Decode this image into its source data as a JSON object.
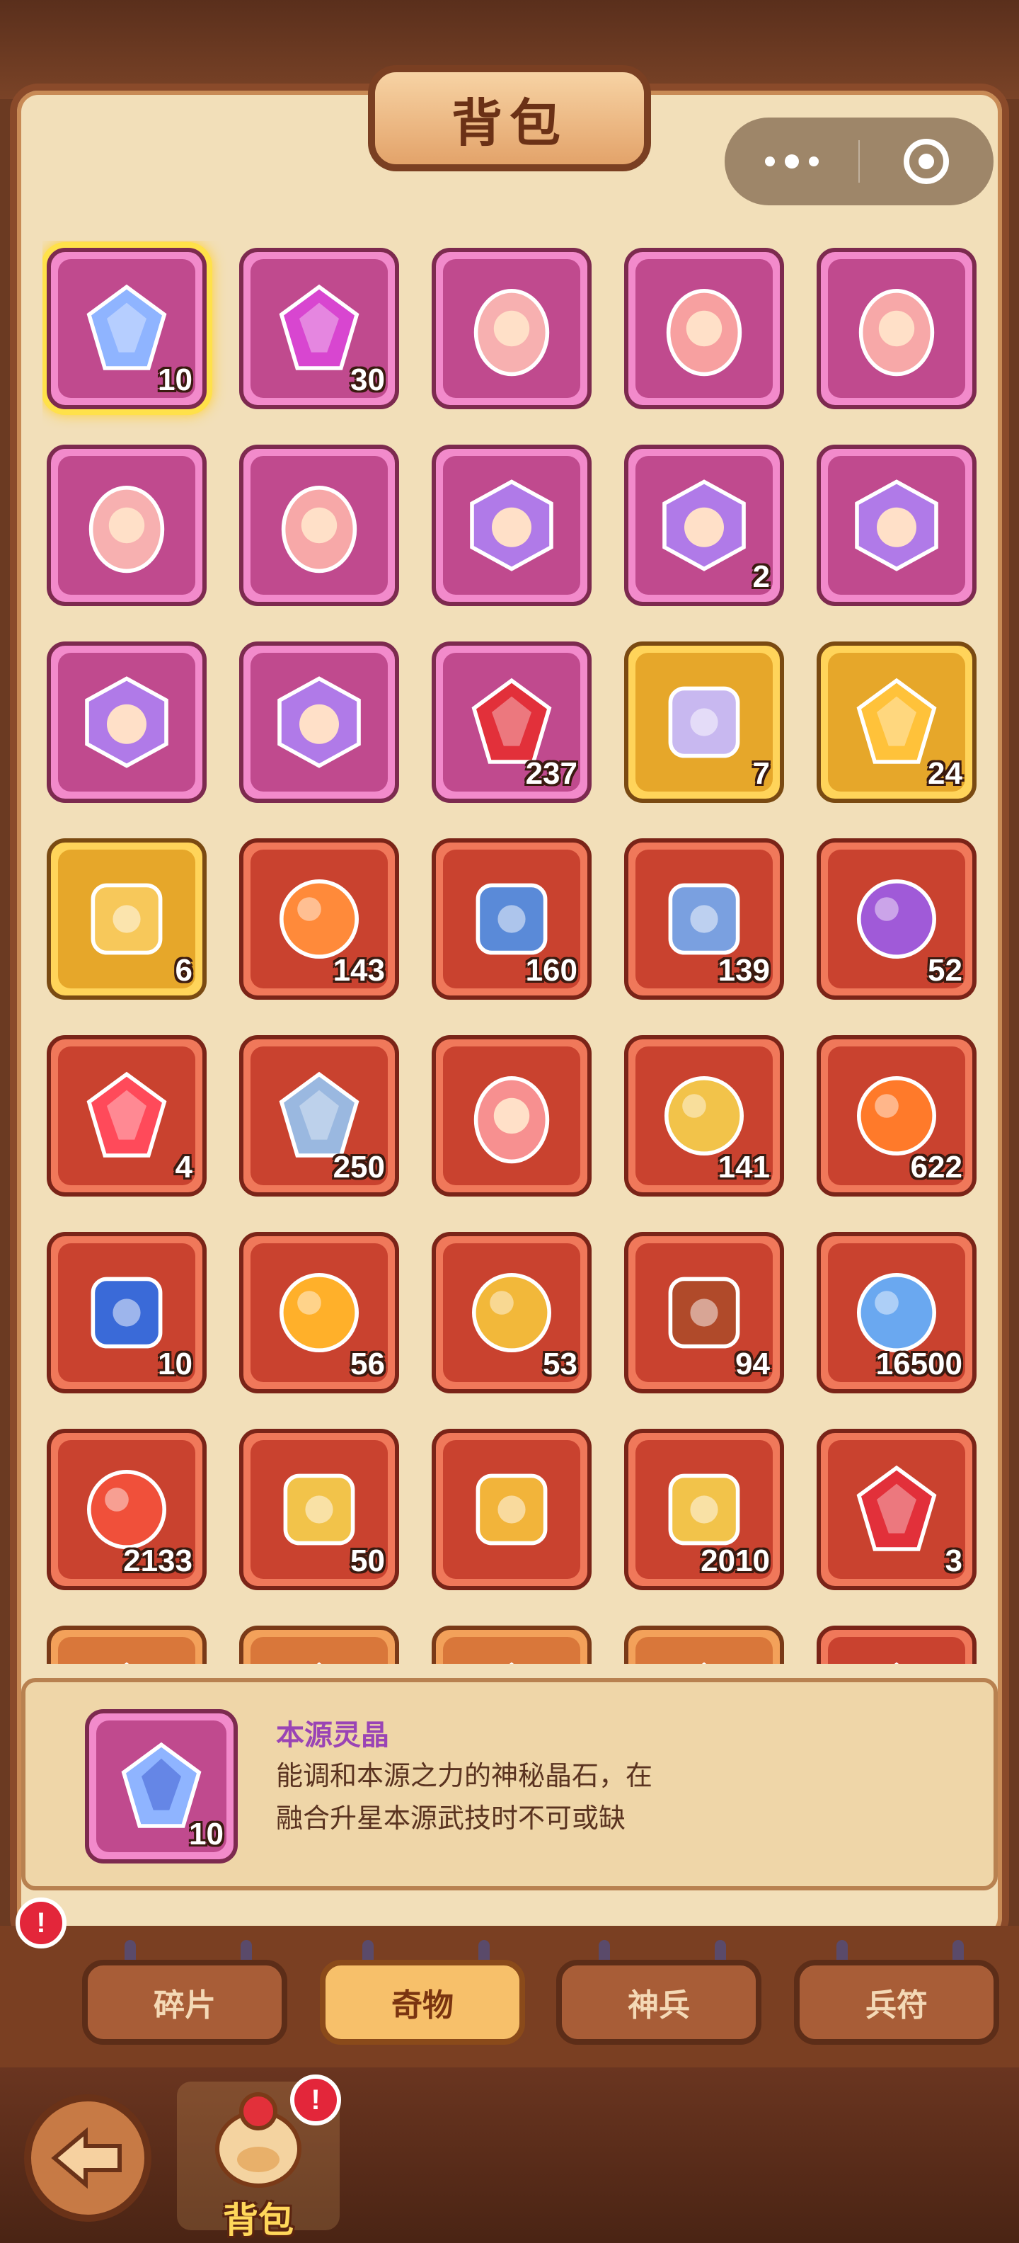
{
  "header": {
    "title": "背包"
  },
  "grid": {
    "items": [
      {
        "name": "crystal-blue-icon",
        "color": "pink",
        "count": "10",
        "selected": true,
        "glyph": "#8fb4ff"
      },
      {
        "name": "crystal-magenta-icon",
        "color": "pink",
        "count": "30",
        "glyph": "#d846d0"
      },
      {
        "name": "hero-egg-icon",
        "color": "pink",
        "count": "",
        "glyph": "#f7b0b0"
      },
      {
        "name": "hero-egg-icon",
        "color": "pink",
        "count": "",
        "glyph": "#f7a0a0"
      },
      {
        "name": "hero-egg-icon",
        "color": "pink",
        "count": "",
        "glyph": "#f7a8a8"
      },
      {
        "name": "hero-egg-icon",
        "color": "pink",
        "count": "",
        "glyph": "#f7b0b0"
      },
      {
        "name": "hero-egg-icon",
        "color": "pink",
        "count": "",
        "glyph": "#f7a8a8"
      },
      {
        "name": "hero-gem-icon",
        "color": "pink",
        "count": "",
        "glyph": "#b07ae8"
      },
      {
        "name": "hero-gem-icon",
        "color": "pink",
        "count": "2",
        "glyph": "#b07ae8"
      },
      {
        "name": "hero-gem-icon",
        "color": "pink",
        "count": "",
        "glyph": "#b07ae8"
      },
      {
        "name": "hero-gem-icon",
        "color": "pink",
        "count": "",
        "glyph": "#b07ae8"
      },
      {
        "name": "hero-gem-icon",
        "color": "pink",
        "count": "",
        "glyph": "#b07ae8"
      },
      {
        "name": "red-crystal-icon",
        "color": "pink",
        "count": "237",
        "glyph": "#e2303a"
      },
      {
        "name": "cards-icon",
        "color": "gold",
        "count": "7",
        "glyph": "#c8b8f0"
      },
      {
        "name": "gold-crystal-icon",
        "color": "gold",
        "count": "24",
        "glyph": "#ffc23a"
      },
      {
        "name": "scroll-gold-icon",
        "color": "gold",
        "count": "6",
        "glyph": "#f7c85a"
      },
      {
        "name": "flame-swirl-icon",
        "color": "red",
        "count": "143",
        "glyph": "#ff8a3a"
      },
      {
        "name": "blue-scroll-icon",
        "color": "red",
        "count": "160",
        "glyph": "#5a8ad8"
      },
      {
        "name": "book-icon",
        "color": "red",
        "count": "139",
        "glyph": "#7aa0e0"
      },
      {
        "name": "purple-orb-icon",
        "color": "red",
        "count": "52",
        "glyph": "#a05ad8"
      },
      {
        "name": "red-stone-icon",
        "color": "red",
        "count": "4",
        "glyph": "#ff4a5a"
      },
      {
        "name": "rune-stone-icon",
        "color": "red",
        "count": "250",
        "glyph": "#9ab8e0"
      },
      {
        "name": "hero-egg-icon",
        "color": "red",
        "count": "",
        "glyph": "#f79090"
      },
      {
        "name": "gold-ring-icon",
        "color": "red",
        "count": "141",
        "glyph": "#f2c34a"
      },
      {
        "name": "fire-orb-icon",
        "color": "red",
        "count": "622",
        "glyph": "#ff7a2a"
      },
      {
        "name": "treasure-chest-icon",
        "color": "red",
        "count": "10",
        "glyph": "#3a6ad8"
      },
      {
        "name": "golden-orb-icon",
        "color": "red",
        "count": "56",
        "glyph": "#ffb02a"
      },
      {
        "name": "golden-bell-icon",
        "color": "red",
        "count": "53",
        "glyph": "#f2b83a"
      },
      {
        "name": "food-box-icon",
        "color": "red",
        "count": "94",
        "glyph": "#b04a2a"
      },
      {
        "name": "potion-bottle-icon",
        "color": "red",
        "count": "16500",
        "glyph": "#6aa8f0"
      },
      {
        "name": "red-cloud-icon",
        "color": "red",
        "count": "2133",
        "glyph": "#f0503a"
      },
      {
        "name": "golden-key-icon",
        "color": "red",
        "count": "50",
        "glyph": "#f2c34a"
      },
      {
        "name": "golden-token-icon",
        "color": "red",
        "count": "",
        "glyph": "#f2b43a"
      },
      {
        "name": "jade-scroll-icon",
        "color": "red",
        "count": "2010",
        "glyph": "#f2c34a"
      },
      {
        "name": "red-jewel-icon",
        "color": "red",
        "count": "3",
        "glyph": "#e2303a"
      },
      {
        "name": "partial-item-icon",
        "color": "orange",
        "count": "",
        "glyph": "#c8b8f0"
      },
      {
        "name": "partial-item-icon",
        "color": "orange",
        "count": "",
        "glyph": "#f2c34a"
      },
      {
        "name": "partial-item-icon",
        "color": "orange",
        "count": "",
        "glyph": "#7aa0e0"
      },
      {
        "name": "partial-item-icon",
        "color": "orange",
        "count": "",
        "glyph": "#f2c34a"
      },
      {
        "name": "partial-item-icon",
        "color": "red",
        "count": "",
        "glyph": "#ff4a5a"
      }
    ]
  },
  "detail": {
    "name": "本源灵晶",
    "line1": "能调和本源之力的神秘晶石，在",
    "line2": "融合升星本源武技时不可或缺",
    "count": "10"
  },
  "tabs": [
    {
      "label": "碎片",
      "active": false,
      "badge": "!"
    },
    {
      "label": "奇物",
      "active": true
    },
    {
      "label": "神兵",
      "active": false
    },
    {
      "label": "兵符",
      "active": false
    }
  ],
  "bottom": {
    "bag_label": "背包",
    "bag_badge": "!"
  }
}
